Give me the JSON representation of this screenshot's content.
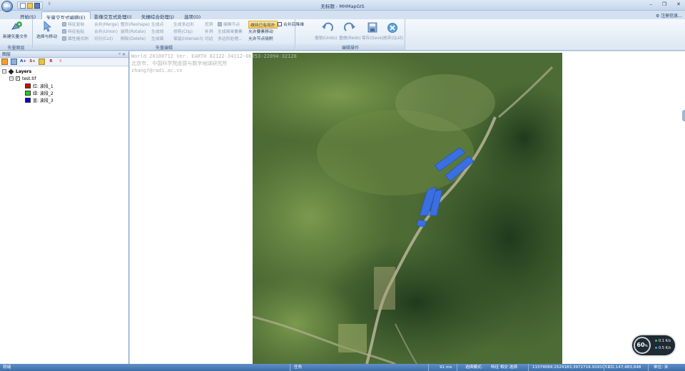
{
  "window": {
    "title": "无标题 - MHMapGIS",
    "logo_text": "GIS",
    "qat_more": "⇩",
    "controls": [
      "–",
      "❐",
      "✕"
    ]
  },
  "tabs": [
    {
      "label": "开始(S)",
      "active": false
    },
    {
      "label": "矢量交互式编辑(E)",
      "active": true
    },
    {
      "label": "影像交互式处理(I)",
      "active": false
    },
    {
      "label": "矢栅综合处理(J)",
      "active": false
    },
    {
      "label": "选项(O)",
      "active": false
    }
  ],
  "register_info": "注册信息...",
  "ribbon": {
    "group_vector_layer": {
      "label": "矢量图层",
      "new_vector_file": "新建矢量文件"
    },
    "group_vector_edit": {
      "label": "矢量编辑",
      "select_move": "选择与移动",
      "col1": [
        "特征复制",
        "特征粘贴",
        "属性格式刷"
      ],
      "col2": [
        "合并(Merge)",
        "合并(Union)",
        "切分(Cut)"
      ],
      "col3": [
        "整形(Reshape)",
        "旋转(Rotate)",
        "删除(Delete)"
      ],
      "col4": [
        "生成点",
        "生成线",
        "生成面"
      ],
      "col5": [
        "生成多边形",
        "修剪(Clip)",
        "保留(Intersect)"
      ],
      "col6": [
        "挖洞",
        "补洞",
        "切边"
      ],
      "col7": [
        "编辑节点",
        "生成简单要素",
        "多边形处理..."
      ],
      "col8": [
        "维持已有拓扑",
        "允许要素移动",
        "允许节点吸附"
      ],
      "merge_break": "合并后降维"
    },
    "group_edit_ops": {
      "label": "编辑操作",
      "undo": "撤销(Undo)",
      "redo": "重做(Redo)",
      "save": "保存(Save)",
      "quit": "放弃(Quit)"
    }
  },
  "layer_panel": {
    "title": "图层",
    "pin": "ᵖ ×",
    "toolbar": [
      "A+",
      "S+",
      "R",
      "⇧"
    ],
    "tree": {
      "root": "Layers",
      "file": "test.tif",
      "bands": [
        {
          "label": "红: 波段_1",
          "color": "#e00000"
        },
        {
          "label": "绿: 波段_2",
          "color": "#1fd11f"
        },
        {
          "label": "蓝: 波段_3",
          "color": "#0000d0"
        }
      ]
    }
  },
  "map": {
    "watermark": [
      "World 20180712 Ver. EARTH 82122-34112-06253-22094-32128",
      "北京市, 中国科学院遥感与数字地球研究所",
      "zhangf@radi.ac.cn"
    ],
    "zoom": "60",
    "zoom_unit": "%",
    "speeds": [
      {
        "value": "0.1",
        "unit": "K/s",
        "color": "#2ecc71"
      },
      {
        "value": "0.5",
        "unit": "K/s",
        "color": "#3aa0ff"
      }
    ]
  },
  "status": {
    "ready": "就绪",
    "task": "任务",
    "fps": "91 ms",
    "mode_label": "选择模式:",
    "mode_value": "特征 相交 选择",
    "coords": "11574064.1524183,3972716.91910517",
    "scale": "1:2,147,483,648",
    "unit": "单位: 米"
  }
}
